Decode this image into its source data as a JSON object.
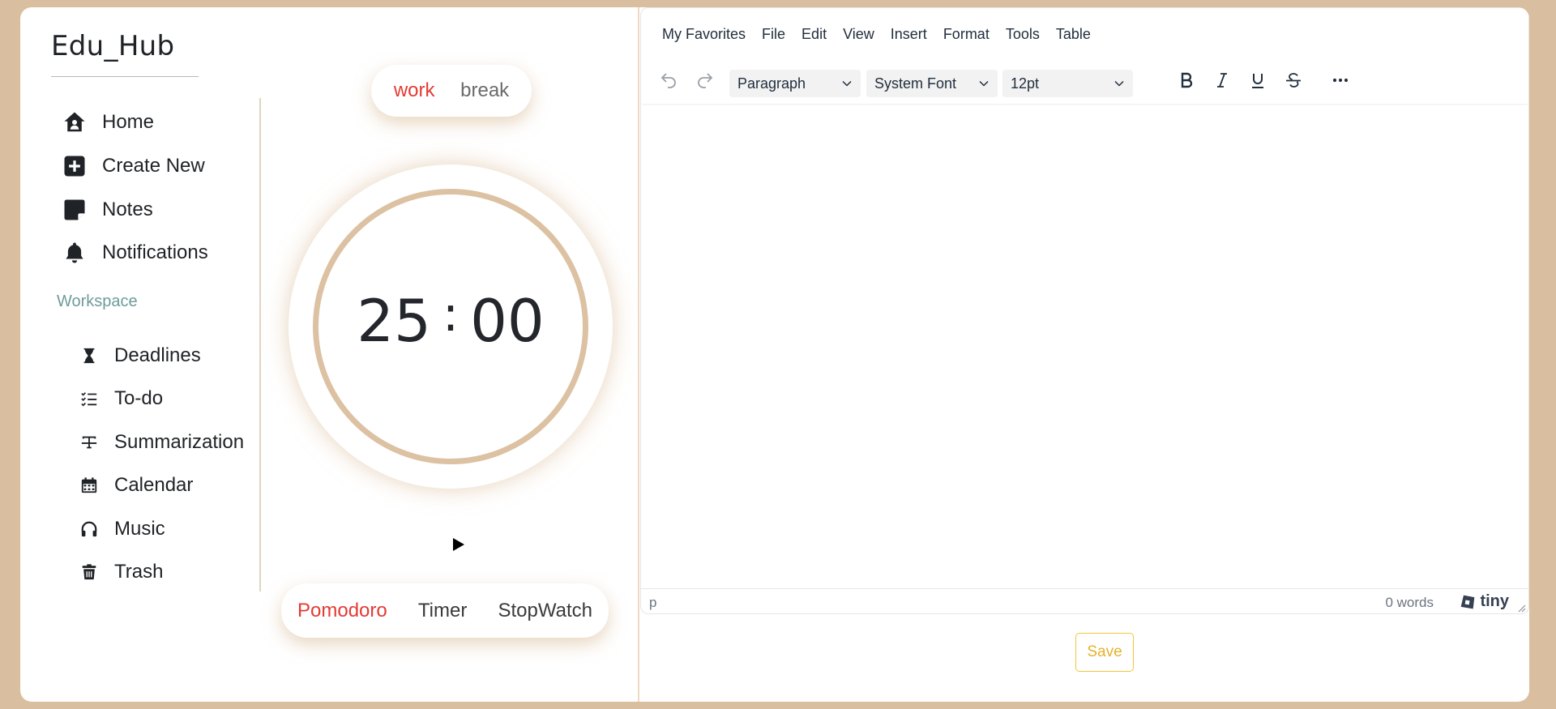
{
  "app": {
    "brand": "Edu_Hub"
  },
  "sidebar": {
    "items": [
      {
        "label": "Home",
        "icon": "home-icon"
      },
      {
        "label": "Create New",
        "icon": "plus-square-icon"
      },
      {
        "label": "Notes",
        "icon": "sticky-note-icon"
      },
      {
        "label": "Notifications",
        "icon": "bell-icon"
      }
    ],
    "workspace_label": "Workspace",
    "workspace_items": [
      {
        "label": "Deadlines",
        "icon": "hourglass-icon"
      },
      {
        "label": "To-do",
        "icon": "checklist-icon"
      },
      {
        "label": "Summarization",
        "icon": "summarize-icon"
      },
      {
        "label": "Calendar",
        "icon": "calendar-icon"
      },
      {
        "label": "Music",
        "icon": "headphones-icon"
      },
      {
        "label": "Trash",
        "icon": "trash-icon"
      }
    ]
  },
  "timer": {
    "modes": {
      "active": "work",
      "inactive": "break"
    },
    "minutes": "25",
    "separator": ":",
    "seconds": "00",
    "play_icon": "play-icon",
    "types": {
      "active": "Pomodoro",
      "second": "Timer",
      "third": "StopWatch"
    }
  },
  "editor": {
    "menu": [
      "My Favorites",
      "File",
      "Edit",
      "View",
      "Insert",
      "Format",
      "Tools",
      "Table"
    ],
    "block_format": "Paragraph",
    "font_family": "System Font",
    "font_size": "12pt",
    "status_path": "p",
    "word_count": "0 words",
    "brand": "tiny",
    "save_label": "Save"
  },
  "colors": {
    "background": "#d9bf9f",
    "accent_red": "#e33b33",
    "ring": "#dcc1a2",
    "workspace_label": "#6f9b9b",
    "save_button": "#e5b22e"
  }
}
